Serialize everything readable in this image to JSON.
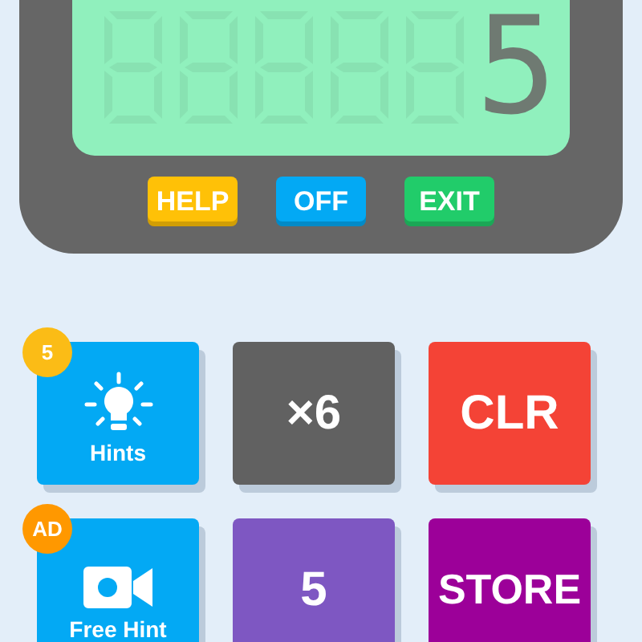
{
  "display": {
    "value": "5"
  },
  "function_buttons": [
    {
      "label": "HELP",
      "color": "#ffc107"
    },
    {
      "label": "OFF",
      "color": "#03a9f4"
    },
    {
      "label": "EXIT",
      "color": "#21cc6a"
    }
  ],
  "tiles": [
    {
      "kind": "hint",
      "label": "Hints",
      "badge": {
        "text": "5",
        "color": "#fbbc16"
      },
      "color": "#03a9f4"
    },
    {
      "kind": "text",
      "label": "×6",
      "color": "#616161"
    },
    {
      "kind": "text",
      "label": "CLR",
      "color": "#f44336"
    },
    {
      "kind": "video",
      "label": "Free Hint",
      "badge": {
        "text": "AD",
        "color": "#ff9800"
      },
      "color": "#03a9f4"
    },
    {
      "kind": "text",
      "label": "5",
      "color": "#7e57c2"
    },
    {
      "kind": "text",
      "label": "STORE",
      "color": "#9c0099"
    }
  ]
}
